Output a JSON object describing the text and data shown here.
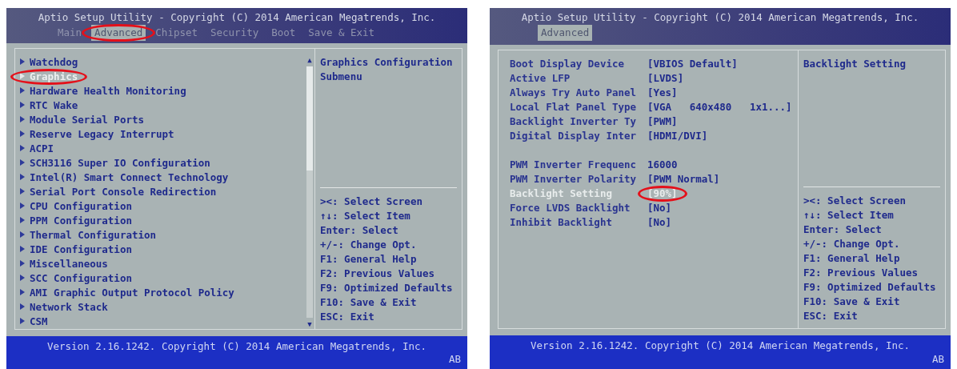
{
  "screens": [
    {
      "kind": "menu",
      "title": "Aptio Setup Utility - Copyright (C) 2014 American Megatrends, Inc.",
      "tabs": [
        {
          "label": "Main",
          "selected": false,
          "circled": false
        },
        {
          "label": "Advanced",
          "selected": true,
          "circled": true
        },
        {
          "label": "Chipset",
          "selected": false,
          "circled": false
        },
        {
          "label": "Security",
          "selected": false,
          "circled": false
        },
        {
          "label": "Boot",
          "selected": false,
          "circled": false
        },
        {
          "label": "Save & Exit",
          "selected": false,
          "circled": false
        }
      ],
      "items": [
        {
          "label": "Watchdog",
          "selected": false,
          "circled": false
        },
        {
          "label": "Graphics",
          "selected": true,
          "circled": true
        },
        {
          "label": "Hardware Health Monitoring",
          "selected": false,
          "circled": false
        },
        {
          "label": "RTC Wake",
          "selected": false,
          "circled": false
        },
        {
          "label": "Module Serial Ports",
          "selected": false,
          "circled": false
        },
        {
          "label": "Reserve Legacy Interrupt",
          "selected": false,
          "circled": false
        },
        {
          "label": "ACPI",
          "selected": false,
          "circled": false
        },
        {
          "label": "SCH3116 Super IO Configuration",
          "selected": false,
          "circled": false
        },
        {
          "label": "Intel(R) Smart Connect Technology",
          "selected": false,
          "circled": false
        },
        {
          "label": "Serial Port Console Redirection",
          "selected": false,
          "circled": false
        },
        {
          "label": "CPU Configuration",
          "selected": false,
          "circled": false
        },
        {
          "label": "PPM Configuration",
          "selected": false,
          "circled": false
        },
        {
          "label": "Thermal Configuration",
          "selected": false,
          "circled": false
        },
        {
          "label": "IDE Configuration",
          "selected": false,
          "circled": false
        },
        {
          "label": "Miscellaneous",
          "selected": false,
          "circled": false
        },
        {
          "label": "SCC Configuration",
          "selected": false,
          "circled": false
        },
        {
          "label": "AMI Graphic Output Protocol Policy",
          "selected": false,
          "circled": false
        },
        {
          "label": "Network Stack",
          "selected": false,
          "circled": false
        },
        {
          "label": "CSM",
          "selected": false,
          "circled": false
        }
      ],
      "scroll_up": "▲",
      "scroll_down": "▼",
      "description": [
        "Graphics Configuration",
        "Submenu"
      ],
      "keys": [
        "><: Select Screen",
        "↑↓: Select Item",
        "Enter: Select",
        "+/-: Change Opt.",
        "F1: General Help",
        "F2: Previous Values",
        "F9: Optimized Defaults",
        "F10: Save & Exit",
        "ESC: Exit"
      ],
      "footer": "Version 2.16.1242. Copyright (C) 2014 American Megatrends, Inc.",
      "corner": "AB"
    },
    {
      "kind": "settings",
      "title": "Aptio Setup Utility - Copyright (C) 2014 American Megatrends, Inc.",
      "tabs": [
        {
          "label": "Advanced",
          "selected": true,
          "circled": false
        }
      ],
      "groups": [
        [
          {
            "label": "Boot Display Device",
            "value": "[VBIOS Default]",
            "selected": false,
            "circled": false
          },
          {
            "label": "Active LFP",
            "value": "[LVDS]",
            "selected": false,
            "circled": false
          },
          {
            "label": "Always Try Auto Panel",
            "value": "[Yes]",
            "selected": false,
            "circled": false
          },
          {
            "label": "Local Flat Panel Type",
            "value": "[VGA   640x480   1x1...]",
            "selected": false,
            "circled": false
          },
          {
            "label": "Backlight Inverter Ty",
            "value": "[PWM]",
            "selected": false,
            "circled": false
          },
          {
            "label": "Digital Display Inter",
            "value": "[HDMI/DVI]",
            "selected": false,
            "circled": false
          }
        ],
        [
          {
            "label": "PWM Inverter Frequenc",
            "value": "16000",
            "selected": false,
            "circled": false
          },
          {
            "label": "PWM Inverter Polarity",
            "value": "[PWM Normal]",
            "selected": false,
            "circled": false
          },
          {
            "label": "Backlight Setting",
            "value": "[90%]",
            "selected": true,
            "circled": true
          },
          {
            "label": "Force LVDS Backlight",
            "value": "[No]",
            "selected": false,
            "circled": false
          },
          {
            "label": "Inhibit Backlight",
            "value": "[No]",
            "selected": false,
            "circled": false
          }
        ]
      ],
      "description": [
        "Backlight Setting"
      ],
      "keys": [
        "><: Select Screen",
        "↑↓: Select Item",
        "Enter: Select",
        "+/-: Change Opt.",
        "F1: General Help",
        "F2: Previous Values",
        "F9: Optimized Defaults",
        "F10: Save & Exit",
        "ESC: Exit"
      ],
      "footer": "Version 2.16.1242. Copyright (C) 2014 American Megatrends, Inc.",
      "corner": "AB"
    }
  ]
}
